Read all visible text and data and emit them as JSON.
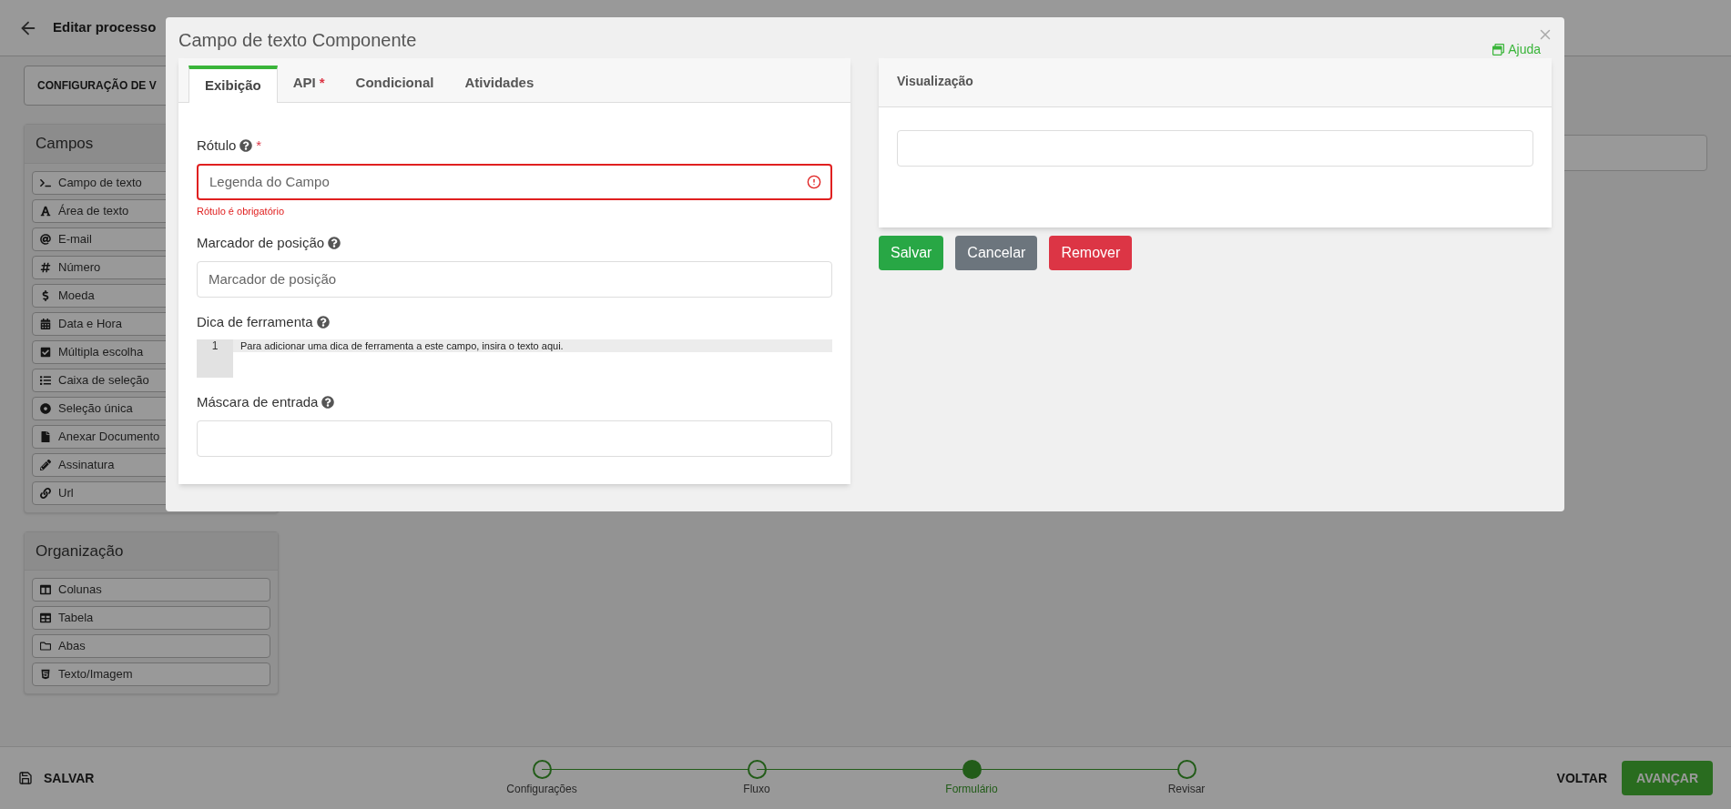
{
  "header": {
    "title": "Editar processo"
  },
  "config_button": "CONFIGURAÇÃO DE V",
  "fields_panel": {
    "title": "Campos",
    "items": [
      "Campo de texto",
      "Área de texto",
      "E-mail",
      "Número",
      "Moeda",
      "Data e Hora",
      "Múltipla escolha",
      "Caixa de seleção",
      "Seleção única",
      "Anexar Documento",
      "Assinatura",
      "Url"
    ]
  },
  "organization_panel": {
    "title": "Organização",
    "items": [
      "Colunas",
      "Tabela",
      "Abas",
      "Texto/Imagem"
    ]
  },
  "modal": {
    "title": "Campo de texto Componente",
    "help_link": "Ajuda",
    "required_mark": "*",
    "tabs": [
      {
        "label": "Exibição",
        "selected": true,
        "required": false
      },
      {
        "label": "API",
        "selected": false,
        "required": true
      },
      {
        "label": "Condicional",
        "selected": false,
        "required": false
      },
      {
        "label": "Atividades",
        "selected": false,
        "required": false
      }
    ],
    "form": [
      {
        "kind": "input",
        "label": "Rótulo",
        "required": true,
        "placeholder": "Legenda do Campo",
        "invalid": true,
        "error": "Rótulo é obrigatório"
      },
      {
        "kind": "input",
        "label": "Marcador de posição",
        "required": false,
        "placeholder": "Marcador de posição",
        "invalid": false
      },
      {
        "kind": "editor",
        "label": "Dica de ferramenta",
        "required": false,
        "line_number": "1",
        "text": "Para adicionar uma dica de ferramenta a este campo, insira o texto aqui."
      },
      {
        "kind": "input",
        "label": "Máscara de entrada",
        "required": false,
        "invalid": false
      }
    ],
    "preview": {
      "title": "Visualização"
    },
    "buttons": [
      {
        "label": "Salvar",
        "kind": "success"
      },
      {
        "label": "Cancelar",
        "kind": "secondary"
      },
      {
        "label": "Remover",
        "kind": "danger"
      }
    ]
  },
  "footer": {
    "save": "SALVAR",
    "steps": [
      {
        "label": "Configurações",
        "selected": false
      },
      {
        "label": "Fluxo",
        "selected": false
      },
      {
        "label": "Formulário",
        "selected": true
      },
      {
        "label": "Revisar",
        "selected": false
      }
    ],
    "back": "VOLTAR",
    "next": "AVANÇAR"
  }
}
